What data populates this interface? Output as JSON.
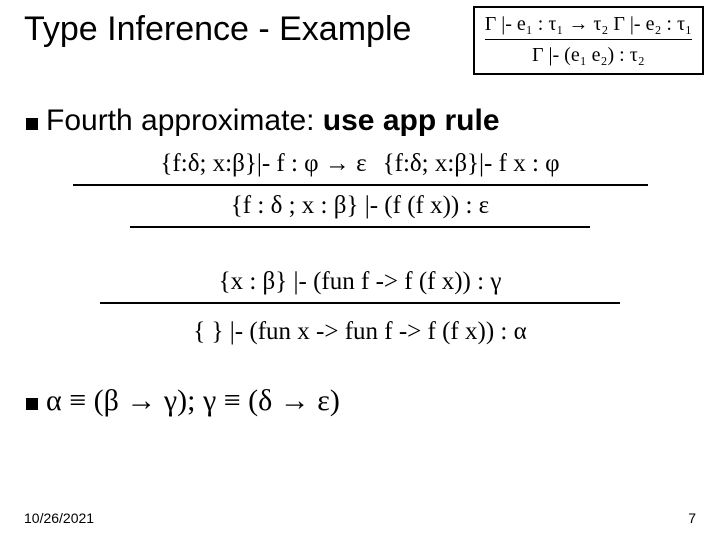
{
  "title": "Type Inference - Example",
  "rulebox": {
    "premise": "Γ |- e₁ : τ₁ → τ₂    Γ |- e₂ : τ₁",
    "conclusion": "Γ |- (e₁ e₂) : τ₂"
  },
  "heading_plain": "Fourth approximate: ",
  "heading_bold": "use app rule",
  "deriv": {
    "premise_left": "{f:δ; x:β}|- f : φ → ε",
    "premise_right": "{f:δ; x:β}|- f x : φ",
    "concl1": "{f : δ ; x : β} |- (f (f x)) : ε",
    "concl2": "{x : β} |- (fun f -> f (f x)) : γ",
    "concl3": "{ } |- (fun x -> fun f -> f (f x)) : α"
  },
  "defs": "α ≡ (β → γ);  γ ≡ (δ → ε)",
  "footer": {
    "date": "10/26/2021",
    "page": "7"
  }
}
